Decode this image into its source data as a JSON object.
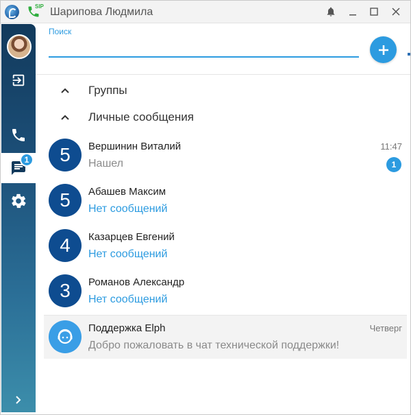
{
  "window": {
    "title": "Шарипова Людмила",
    "sip_label": "SIP"
  },
  "search": {
    "label": "Поиск",
    "value": "",
    "placeholder": ""
  },
  "sidebar": {
    "chat_badge": "1"
  },
  "sections": {
    "groups": "Группы",
    "personal": "Личные сообщения"
  },
  "chats": [
    {
      "avatar": "5",
      "name": "Вершинин Виталий",
      "message": "Нашел",
      "time": "11:47",
      "unread": "1"
    },
    {
      "avatar": "5",
      "name": "Абашев Максим",
      "message": "Нет сообщений"
    },
    {
      "avatar": "4",
      "name": "Казарцев Евгений",
      "message": "Нет сообщений"
    },
    {
      "avatar": "3",
      "name": "Романов Александр",
      "message": "Нет сообщений"
    }
  ],
  "support": {
    "name": "Поддержка Elph",
    "message": "Добро пожаловать в чат технической поддержки!",
    "time": "Четверг",
    "icon": "support-agent-icon"
  },
  "colors": {
    "accent": "#2c9be0",
    "avatar_dark": "#0e4c90",
    "sidebar_top": "#123a5c",
    "sidebar_bottom": "#3c8eab"
  }
}
